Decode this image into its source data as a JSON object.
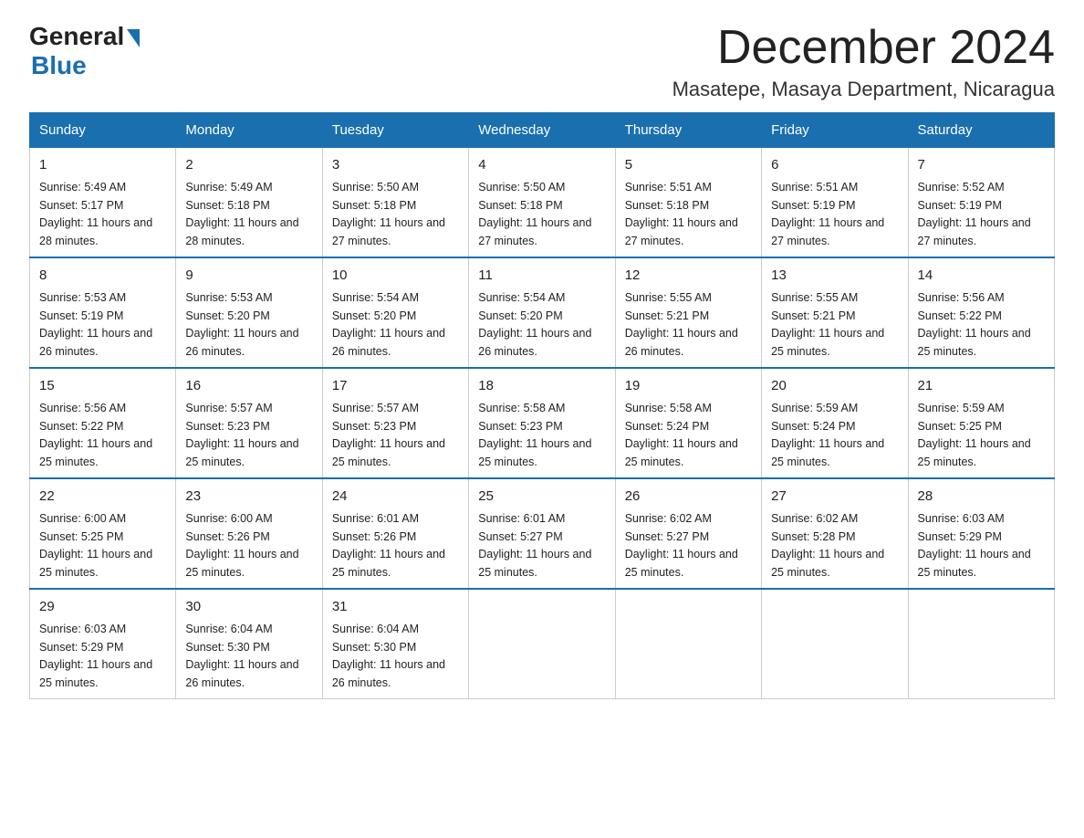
{
  "logo": {
    "general": "General",
    "blue": "Blue"
  },
  "title": "December 2024",
  "location": "Masatepe, Masaya Department, Nicaragua",
  "days_of_week": [
    "Sunday",
    "Monday",
    "Tuesday",
    "Wednesday",
    "Thursday",
    "Friday",
    "Saturday"
  ],
  "weeks": [
    [
      {
        "day": "1",
        "sunrise": "5:49 AM",
        "sunset": "5:17 PM",
        "daylight": "11 hours and 28 minutes."
      },
      {
        "day": "2",
        "sunrise": "5:49 AM",
        "sunset": "5:18 PM",
        "daylight": "11 hours and 28 minutes."
      },
      {
        "day": "3",
        "sunrise": "5:50 AM",
        "sunset": "5:18 PM",
        "daylight": "11 hours and 27 minutes."
      },
      {
        "day": "4",
        "sunrise": "5:50 AM",
        "sunset": "5:18 PM",
        "daylight": "11 hours and 27 minutes."
      },
      {
        "day": "5",
        "sunrise": "5:51 AM",
        "sunset": "5:18 PM",
        "daylight": "11 hours and 27 minutes."
      },
      {
        "day": "6",
        "sunrise": "5:51 AM",
        "sunset": "5:19 PM",
        "daylight": "11 hours and 27 minutes."
      },
      {
        "day": "7",
        "sunrise": "5:52 AM",
        "sunset": "5:19 PM",
        "daylight": "11 hours and 27 minutes."
      }
    ],
    [
      {
        "day": "8",
        "sunrise": "5:53 AM",
        "sunset": "5:19 PM",
        "daylight": "11 hours and 26 minutes."
      },
      {
        "day": "9",
        "sunrise": "5:53 AM",
        "sunset": "5:20 PM",
        "daylight": "11 hours and 26 minutes."
      },
      {
        "day": "10",
        "sunrise": "5:54 AM",
        "sunset": "5:20 PM",
        "daylight": "11 hours and 26 minutes."
      },
      {
        "day": "11",
        "sunrise": "5:54 AM",
        "sunset": "5:20 PM",
        "daylight": "11 hours and 26 minutes."
      },
      {
        "day": "12",
        "sunrise": "5:55 AM",
        "sunset": "5:21 PM",
        "daylight": "11 hours and 26 minutes."
      },
      {
        "day": "13",
        "sunrise": "5:55 AM",
        "sunset": "5:21 PM",
        "daylight": "11 hours and 25 minutes."
      },
      {
        "day": "14",
        "sunrise": "5:56 AM",
        "sunset": "5:22 PM",
        "daylight": "11 hours and 25 minutes."
      }
    ],
    [
      {
        "day": "15",
        "sunrise": "5:56 AM",
        "sunset": "5:22 PM",
        "daylight": "11 hours and 25 minutes."
      },
      {
        "day": "16",
        "sunrise": "5:57 AM",
        "sunset": "5:23 PM",
        "daylight": "11 hours and 25 minutes."
      },
      {
        "day": "17",
        "sunrise": "5:57 AM",
        "sunset": "5:23 PM",
        "daylight": "11 hours and 25 minutes."
      },
      {
        "day": "18",
        "sunrise": "5:58 AM",
        "sunset": "5:23 PM",
        "daylight": "11 hours and 25 minutes."
      },
      {
        "day": "19",
        "sunrise": "5:58 AM",
        "sunset": "5:24 PM",
        "daylight": "11 hours and 25 minutes."
      },
      {
        "day": "20",
        "sunrise": "5:59 AM",
        "sunset": "5:24 PM",
        "daylight": "11 hours and 25 minutes."
      },
      {
        "day": "21",
        "sunrise": "5:59 AM",
        "sunset": "5:25 PM",
        "daylight": "11 hours and 25 minutes."
      }
    ],
    [
      {
        "day": "22",
        "sunrise": "6:00 AM",
        "sunset": "5:25 PM",
        "daylight": "11 hours and 25 minutes."
      },
      {
        "day": "23",
        "sunrise": "6:00 AM",
        "sunset": "5:26 PM",
        "daylight": "11 hours and 25 minutes."
      },
      {
        "day": "24",
        "sunrise": "6:01 AM",
        "sunset": "5:26 PM",
        "daylight": "11 hours and 25 minutes."
      },
      {
        "day": "25",
        "sunrise": "6:01 AM",
        "sunset": "5:27 PM",
        "daylight": "11 hours and 25 minutes."
      },
      {
        "day": "26",
        "sunrise": "6:02 AM",
        "sunset": "5:27 PM",
        "daylight": "11 hours and 25 minutes."
      },
      {
        "day": "27",
        "sunrise": "6:02 AM",
        "sunset": "5:28 PM",
        "daylight": "11 hours and 25 minutes."
      },
      {
        "day": "28",
        "sunrise": "6:03 AM",
        "sunset": "5:29 PM",
        "daylight": "11 hours and 25 minutes."
      }
    ],
    [
      {
        "day": "29",
        "sunrise": "6:03 AM",
        "sunset": "5:29 PM",
        "daylight": "11 hours and 25 minutes."
      },
      {
        "day": "30",
        "sunrise": "6:04 AM",
        "sunset": "5:30 PM",
        "daylight": "11 hours and 26 minutes."
      },
      {
        "day": "31",
        "sunrise": "6:04 AM",
        "sunset": "5:30 PM",
        "daylight": "11 hours and 26 minutes."
      },
      null,
      null,
      null,
      null
    ]
  ]
}
